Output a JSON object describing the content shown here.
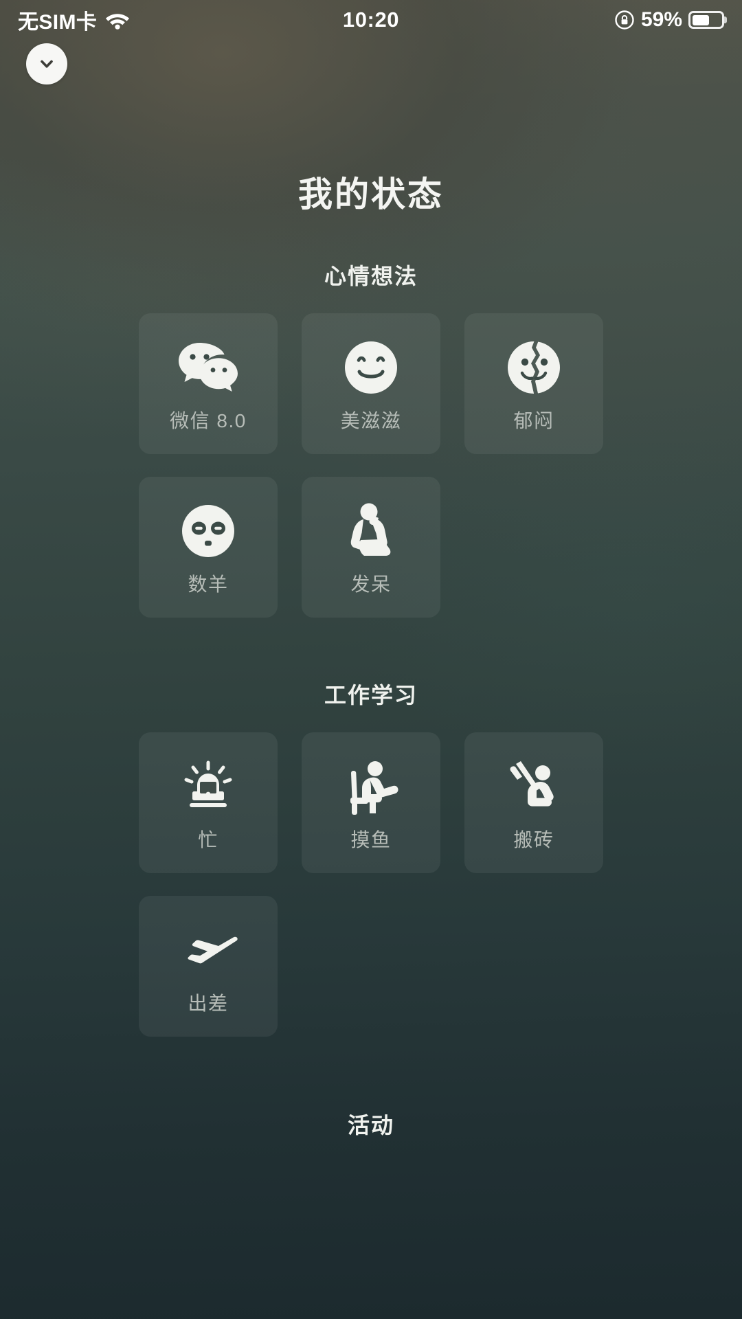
{
  "status_bar": {
    "carrier": "无SIM卡",
    "wifi_icon": "wifi-icon",
    "time": "10:20",
    "rotation_lock_icon": "rotation-lock-icon",
    "battery_percent": "59%",
    "battery_icon": "battery-icon",
    "battery_level": 59
  },
  "close_button": {
    "icon": "chevron-down-icon"
  },
  "page_title": "我的状态",
  "sections": [
    {
      "id": "mood",
      "header": "心情想法",
      "items": [
        {
          "label": "微信 8.0",
          "icon": "wechat-logo-icon"
        },
        {
          "label": "美滋滋",
          "icon": "smiley-face-icon"
        },
        {
          "label": "郁闷",
          "icon": "cracked-face-icon"
        },
        {
          "label": "数羊",
          "icon": "sleepy-face-icon"
        },
        {
          "label": "发呆",
          "icon": "thinker-person-icon"
        }
      ]
    },
    {
      "id": "work",
      "header": "工作学习",
      "items": [
        {
          "label": "忙",
          "icon": "alarm-siren-icon"
        },
        {
          "label": "摸鱼",
          "icon": "person-sitting-chair-icon"
        },
        {
          "label": "搬砖",
          "icon": "person-digging-icon"
        },
        {
          "label": "出差",
          "icon": "airplane-icon"
        }
      ]
    }
  ],
  "bottom_section_header": "活动",
  "colors": {
    "background_top": "#5a574a",
    "background_bottom": "#1c2a2e",
    "card_fill": "rgba(255,255,255,0.062)",
    "label_text": "#b7bdb8",
    "heading_text": "#f0f2ee",
    "icon_white": "#f2f3ef"
  }
}
